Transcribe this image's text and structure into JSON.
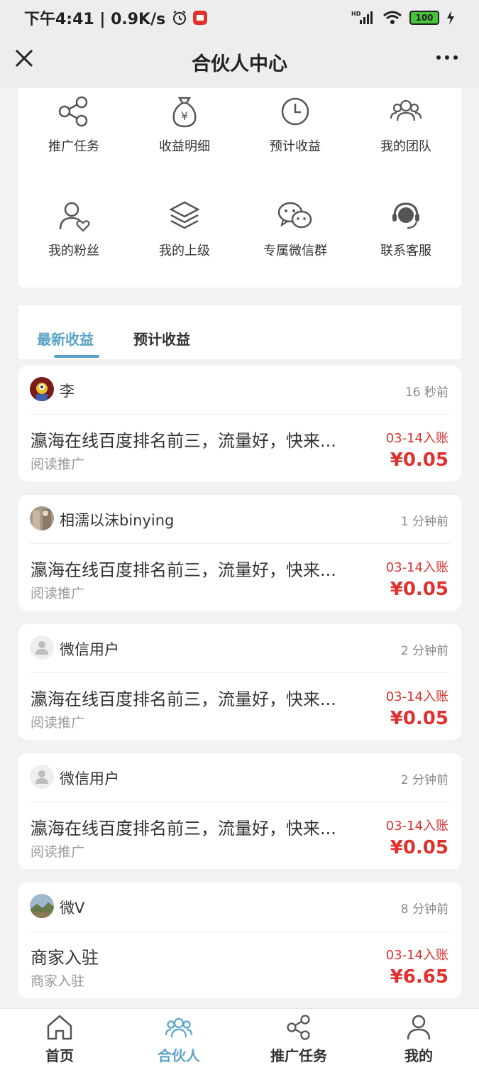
{
  "status_bar": {
    "time_speed": "下午4:41 | 0.9K/s",
    "battery": "100",
    "network": "HD"
  },
  "header": {
    "title": "合伙人中心"
  },
  "grid": {
    "items": [
      {
        "label": "推广任务",
        "icon": "share-icon"
      },
      {
        "label": "收益明细",
        "icon": "money-bag-icon"
      },
      {
        "label": "预计收益",
        "icon": "clock-icon"
      },
      {
        "label": "我的团队",
        "icon": "team-icon"
      },
      {
        "label": "我的粉丝",
        "icon": "fan-icon"
      },
      {
        "label": "我的上级",
        "icon": "layers-icon"
      },
      {
        "label": "专属微信群",
        "icon": "wechat-icon"
      },
      {
        "label": "联系客服",
        "icon": "headset-icon"
      }
    ]
  },
  "tabs": {
    "active": "最新收益",
    "inactive": "预计收益"
  },
  "accent_color": "#5aa3c7",
  "amount_color": "#e0312f",
  "entries": [
    {
      "user": "李",
      "time": "16 秒前",
      "headline": "瀛海在线百度排名前三，流量好，快来...",
      "subtype": "阅读推广",
      "date": "03-14入账",
      "amount": "¥0.05",
      "avatar": "avatar-minion"
    },
    {
      "user": "相濡以沫binying",
      "time": "1 分钟前",
      "headline": "瀛海在线百度排名前三，流量好，快来...",
      "subtype": "阅读推广",
      "date": "03-14入账",
      "amount": "¥0.05",
      "avatar": "avatar-photo"
    },
    {
      "user": "微信用户",
      "time": "2 分钟前",
      "headline": "瀛海在线百度排名前三，流量好，快来...",
      "subtype": "阅读推广",
      "date": "03-14入账",
      "amount": "¥0.05",
      "avatar": "avatar-default"
    },
    {
      "user": "微信用户",
      "time": "2 分钟前",
      "headline": "瀛海在线百度排名前三，流量好，快来...",
      "subtype": "阅读推广",
      "date": "03-14入账",
      "amount": "¥0.05",
      "avatar": "avatar-default"
    },
    {
      "user": "微V",
      "time": "8 分钟前",
      "headline": "商家入驻",
      "subtype": "商家入驻",
      "date": "03-14入账",
      "amount": "¥6.65",
      "avatar": "avatar-landscape"
    }
  ],
  "bottom_nav": {
    "items": [
      {
        "label": "首页",
        "icon": "home-icon"
      },
      {
        "label": "合伙人",
        "icon": "partner-icon"
      },
      {
        "label": "推广任务",
        "icon": "share-icon"
      },
      {
        "label": "我的",
        "icon": "user-icon"
      }
    ],
    "active_index": 1
  }
}
